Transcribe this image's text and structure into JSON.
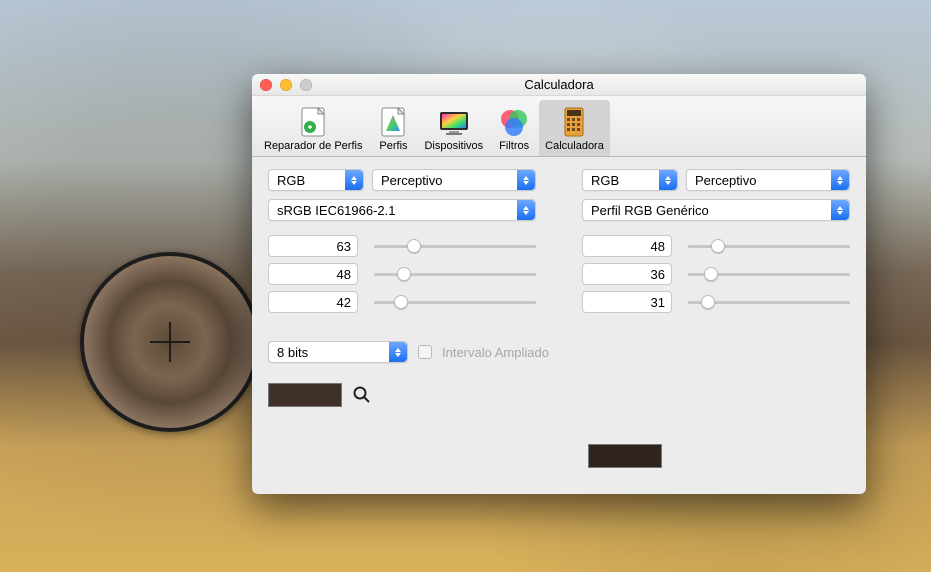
{
  "window": {
    "title": "Calculadora"
  },
  "toolbar": {
    "items": [
      {
        "label": "Reparador de Perfis"
      },
      {
        "label": "Perfis"
      },
      {
        "label": "Dispositivos"
      },
      {
        "label": "Filtros"
      },
      {
        "label": "Calculadora"
      }
    ],
    "selected_index": 4
  },
  "left": {
    "mode": "RGB",
    "intent": "Perceptivo",
    "profile": "sRGB IEC61966-2.1",
    "values": [
      63,
      48,
      42
    ],
    "value_max": 255,
    "swatch_color": "#3f302a"
  },
  "right": {
    "mode": "RGB",
    "intent": "Perceptivo",
    "profile": "Perfil RGB Genérico",
    "values": [
      48,
      36,
      31
    ],
    "value_max": 255,
    "swatch_color": "#30241f"
  },
  "bit_depth": "8 bits",
  "extended_range": {
    "label": "Intervalo Ampliado",
    "checked": false
  }
}
